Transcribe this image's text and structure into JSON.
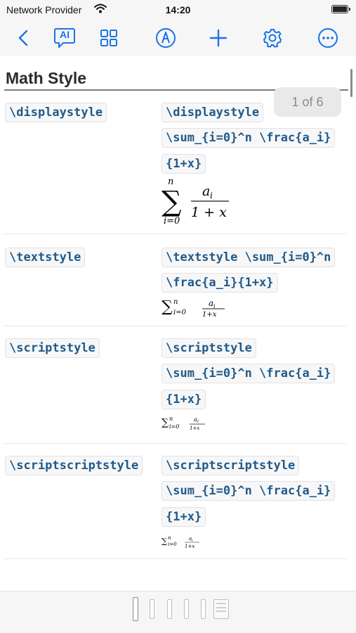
{
  "status": {
    "carrier": "Network Provider",
    "time": "14:20"
  },
  "toolbar": {
    "ai_label": "AI"
  },
  "page": {
    "title": "Math Style",
    "page_indicator": "1 of 6"
  },
  "rows": [
    {
      "command": "\\displaystyle",
      "example_lines": [
        "\\displaystyle",
        "\\sum_{i=0}^n \\frac{a_i}",
        "{1+x}"
      ],
      "render": {
        "op": "∑",
        "upper": "n",
        "lower": "i=0",
        "num": "a",
        "num_sub": "i",
        "den": "1 + x"
      }
    },
    {
      "command": "\\textstyle",
      "example_lines": [
        "\\textstyle \\sum_{i=0}^n",
        "\\frac{a_i}{1+x}"
      ],
      "render": {
        "op": "∑",
        "upper": "n",
        "lower": "i=0",
        "num": "a",
        "num_sub": "i",
        "den": "1+x"
      }
    },
    {
      "command": "\\scriptstyle",
      "example_lines": [
        "\\scriptstyle",
        "\\sum_{i=0}^n \\frac{a_i}",
        "{1+x}"
      ],
      "render": {
        "op": "∑",
        "upper": "n",
        "lower": "i=0",
        "num": "a",
        "num_sub": "i",
        "den": "1+x"
      }
    },
    {
      "command": "\\scriptscriptstyle",
      "example_lines": [
        "\\scriptscriptstyle",
        "\\sum_{i=0}^n \\frac{a_i}",
        "{1+x}"
      ],
      "render": {
        "op": "∑",
        "upper": "n",
        "lower": "i=0",
        "num": "a",
        "num_sub": "i",
        "den": "1+x"
      }
    }
  ],
  "icons": {
    "back": "chevron-left-icon",
    "ai": "ai-chat-icon",
    "grid": "grid-icon",
    "markup": "pen-markup-icon",
    "add": "plus-icon",
    "settings": "gear-icon",
    "more": "ellipsis-circle-icon"
  },
  "colors": {
    "accent": "#1a73e8",
    "code_text": "#1f5a8a"
  }
}
